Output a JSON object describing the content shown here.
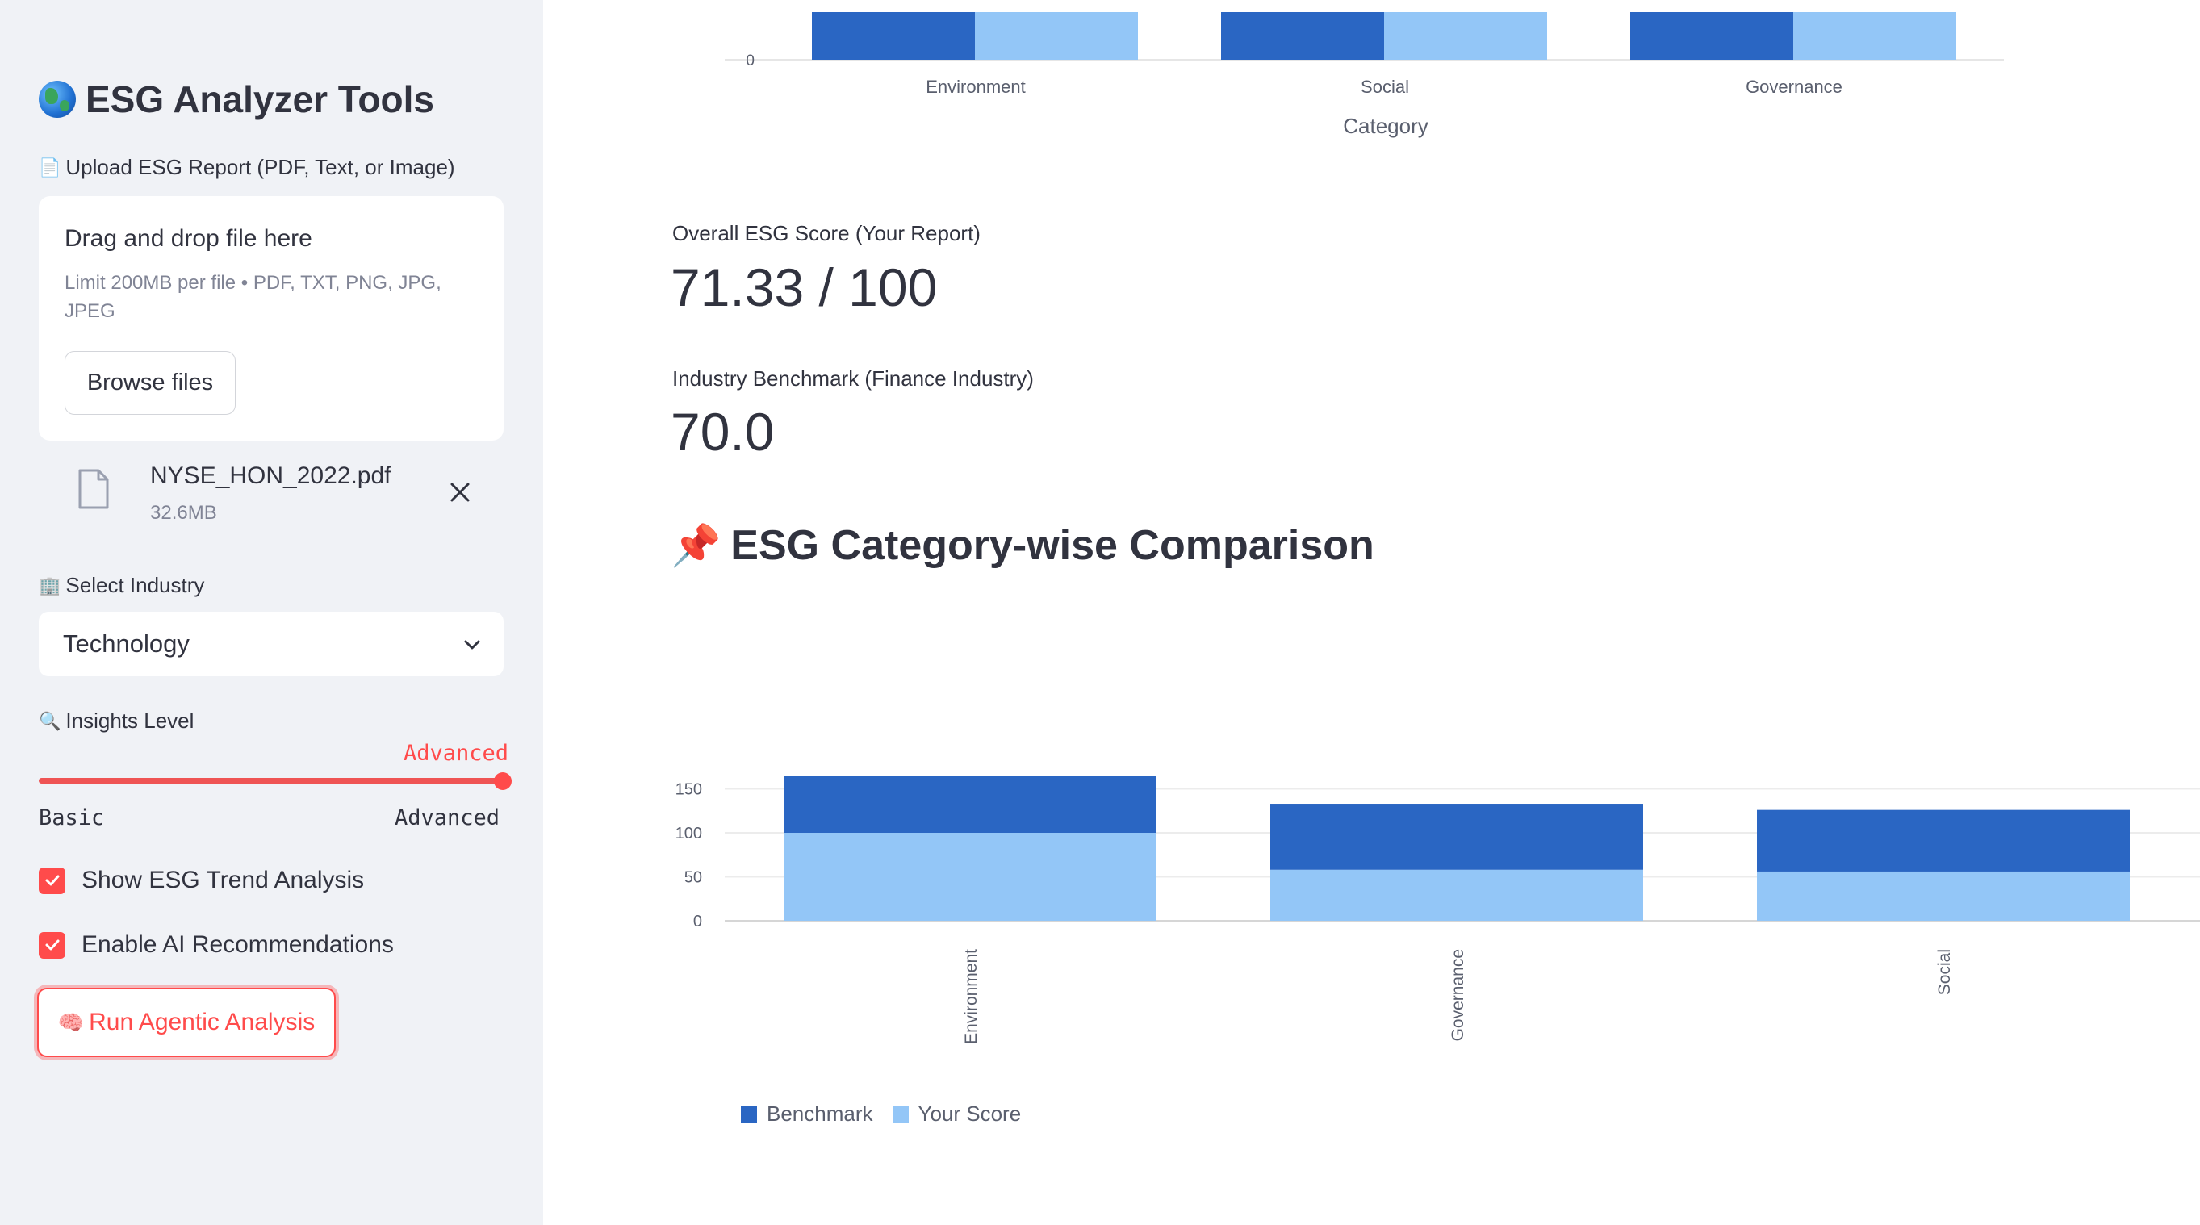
{
  "sidebar": {
    "title": "ESG Analyzer Tools",
    "upload_label": "Upload ESG Report (PDF, Text, or Image)",
    "dropzone_title": "Drag and drop file here",
    "dropzone_hint": "Limit 200MB per file • PDF, TXT, PNG, JPG, JPEG",
    "browse_label": "Browse files",
    "file_name": "NYSE_HON_2022.pdf",
    "file_size": "32.6MB",
    "industry_label": "Select Industry",
    "industry_value": "Technology",
    "insights_label": "Insights Level",
    "insights_value": "Advanced",
    "insights_level_fraction": 1.0,
    "insights_min": "Basic",
    "insights_max": "Advanced",
    "checkbox_trend": "Show ESG Trend Analysis",
    "checkbox_trend_checked": true,
    "checkbox_ai": "Enable AI Recommendations",
    "checkbox_ai_checked": true,
    "run_button": "Run Agentic Analysis"
  },
  "main": {
    "overall_label": "Overall ESG Score (Your Report)",
    "overall_value": "71.33 / 100",
    "benchmark_label": "Industry Benchmark (Finance Industry)",
    "benchmark_value": "70.0",
    "section_title": "ESG Category-wise Comparison"
  },
  "colors": {
    "accent": "#ff4b4b",
    "benchmark": "#2a66c3",
    "your_score": "#93c6f7",
    "sidebar_bg": "#f0f2f6"
  },
  "chart_data": [
    {
      "type": "bar",
      "categories": [
        "Environment",
        "Social",
        "Governance"
      ],
      "series": [
        {
          "name": "Benchmark"
        },
        {
          "name": "Your Score"
        }
      ],
      "xlabel": "Category",
      "yticks": [
        "0"
      ],
      "note": "grouped bar chart, only the bottom portion is visible"
    },
    {
      "type": "bar",
      "stacked": true,
      "categories": [
        "Environment",
        "Governance",
        "Social"
      ],
      "series": [
        {
          "name": "Your Score",
          "values": [
            100,
            58,
            56
          ]
        },
        {
          "name": "Benchmark",
          "values": [
            65,
            75,
            70
          ]
        }
      ],
      "yticks": [
        0,
        50,
        100,
        150
      ],
      "ylim": [
        0,
        165
      ],
      "legend": [
        "Benchmark",
        "Your Score"
      ],
      "legend_position": "bottom-left",
      "grid": true
    }
  ]
}
